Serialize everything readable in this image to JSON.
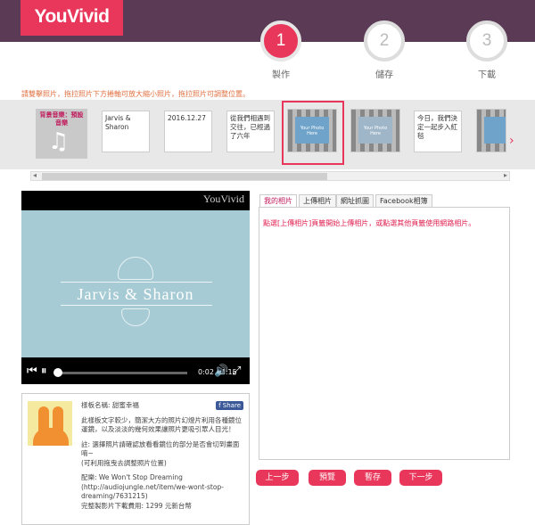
{
  "header": {
    "logo": "YouVivid"
  },
  "steps": [
    {
      "num": "1",
      "label": "製作"
    },
    {
      "num": "2",
      "label": "儲存"
    },
    {
      "num": "3",
      "label": "下載"
    }
  ],
  "instruction": "請雙擊照片，拖拉照片下方捲軸可放大縮小照片，拖拉照片可調整位置。",
  "strip": {
    "music_label": "背景音樂：預設音樂",
    "texts": [
      "Jarvis & Sharon",
      "2016.12.27",
      "從我們相遇到交往，已經過了六年",
      "今日，我們決定一起步入紅毯"
    ],
    "photo_caption": "Your Photo Here"
  },
  "player": {
    "watermark": "YouVivid",
    "title": "Jarvis & Sharon",
    "time": "0:02 / 4:15",
    "progress": 0.008
  },
  "info": {
    "template_line": "樣板名稱: 甜蜜幸福",
    "desc": "此樣板文字較少，簡潔大方的照片幻燈片利用各種鏡位運鏡，以及淡淡的幾何效果讓照片更吸引眾人目光！",
    "note1": "註: 選擇照片請確認放看看鏡位的部分是否會切到畫面唷~",
    "note2": "(可利用拖曳去調整照片位置)",
    "music_credit": "配樂: We Won't Stop Dreaming",
    "music_url": "(http://audiojungle.net/item/we-wont-stop-dreaming/7631215)",
    "price": "完整製影片下載費用: 1299 元新台幣",
    "fb_label": "Share"
  },
  "tabs": [
    "我的相片",
    "上傳相片",
    "網址抓圖",
    "Facebook相簿"
  ],
  "panel_message": "點選[上傳相片]頁籤開始上傳相片，或點選其他頁籤使用網路相片。",
  "buttons": [
    "上一步",
    "預覽",
    "暫存",
    "下一步"
  ],
  "colors": {
    "accent": "#e8375b",
    "topbar": "#5a3a55"
  }
}
